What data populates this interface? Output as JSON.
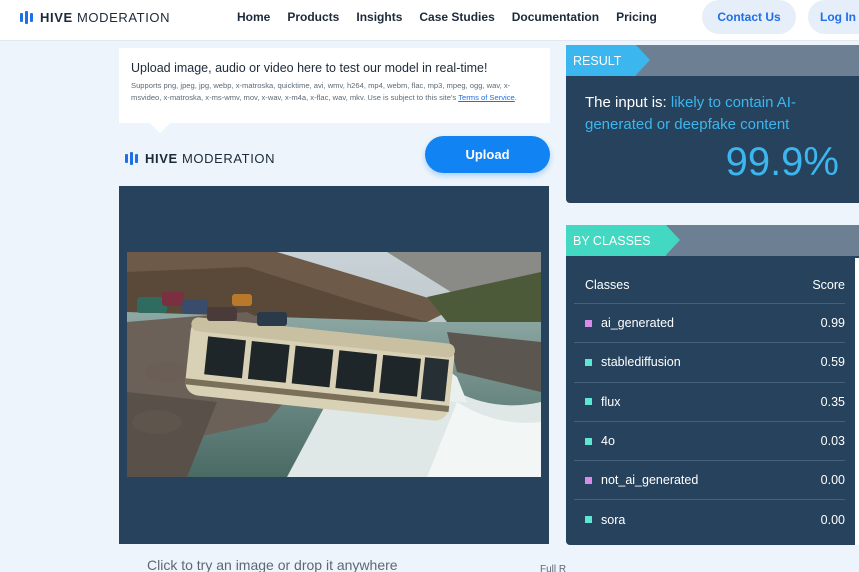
{
  "nav": {
    "brand_bold": "HIVE",
    "brand_light": "MODERATION",
    "links": [
      "Home",
      "Products",
      "Insights",
      "Case Studies",
      "Documentation",
      "Pricing"
    ],
    "contact_label": "Contact Us",
    "login_label": "Log In"
  },
  "upload": {
    "title": "Upload image, audio or video here to test our model in real-time!",
    "formats_text": "Supports png, jpeg, jpg, webp, x-matroska, quicktime, avi, wmv, h264, mp4, webm, flac, mp3, mpeg, ogg, wav, x-msvideo, x-matroska, x-ms-wmv, mov, x-wav, x-m4a, x-flac, wav, mkv. Use is subject to this site's ",
    "terms_link": "Terms of Service",
    "formats_end": ".",
    "upload_label": "Upload",
    "hint": "Click to try an image or drop it anywhere",
    "hint_right": "Full R"
  },
  "result": {
    "ribbon_label": "RESULT",
    "verdict_prefix": "The input is: ",
    "verdict_highlight": "likely to contain AI-generated or deepfake content",
    "score": "99.9%"
  },
  "classes": {
    "ribbon_label": "BY CLASSES",
    "col_class": "Classes",
    "col_score": "Score",
    "rows": [
      {
        "name": "ai_generated",
        "score": "0.99",
        "color": "#d98be8"
      },
      {
        "name": "stablediffusion",
        "score": "0.59",
        "color": "#5ee6d3"
      },
      {
        "name": "flux",
        "score": "0.35",
        "color": "#5ee6d3"
      },
      {
        "name": "4o",
        "score": "0.03",
        "color": "#5ee6d3"
      },
      {
        "name": "not_ai_generated",
        "score": "0.00",
        "color": "#d98be8"
      },
      {
        "name": "sora",
        "score": "0.00",
        "color": "#5ee6d3"
      }
    ]
  },
  "colors": {
    "accent_blue": "#3cb6ee",
    "accent_teal": "#42d8c1",
    "panel_navy": "#26425c",
    "brand_blue": "#1e6fe8"
  },
  "icons": {
    "logo": "hive-logo-bars-icon"
  }
}
